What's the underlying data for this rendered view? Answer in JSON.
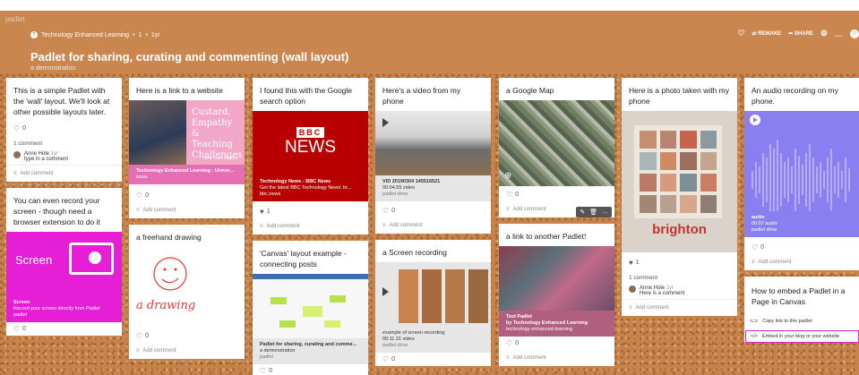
{
  "brand": "padlet",
  "breadcrumb": {
    "org": "Technology Enhanced Learning",
    "count": "1",
    "age": "1yr"
  },
  "title": "Padlet for sharing, curating and commenting (wall layout)",
  "subtitle": "a demonstration",
  "actions": {
    "remake": "REMAKE",
    "share": "SHARE"
  },
  "columns": [
    {
      "cards": [
        {
          "text": "This is a simple Padlet with the 'wall' layout. We'll look at other possible layouts later.",
          "likes": "0",
          "comments_count": "1 comment",
          "comment": {
            "author": "Anne Hole",
            "age": "1yr",
            "text": "type in a comment"
          },
          "add_comment": "Add comment"
        },
        {
          "text": "You can even record your screen - though need a browser extension to do it",
          "attachment": {
            "thumb_title": "Screen",
            "title": "Screen",
            "desc": "Record your screen directly from Padlet",
            "source": "padlet"
          },
          "likes": "0"
        }
      ]
    },
    {
      "cards": [
        {
          "text": "Here is a link to a website",
          "attachment": {
            "thumb_text": "Custard, Empathy & Teaching Challenges",
            "thumb_small": "New Case Studies",
            "title": "Technology Enhanced Learning : Univer...",
            "source": "issuu"
          },
          "likes": "0",
          "add_comment": "Add comment"
        },
        {
          "text": "a freehand drawing",
          "drawing_label": "a drawing",
          "likes": "0",
          "add_comment": "Add comment"
        }
      ]
    },
    {
      "cards": [
        {
          "text": "I found this with the Google search option",
          "attachment": {
            "thumb_logo": "BBC",
            "thumb_news": "NEWS",
            "title": "Technology News - BBC News",
            "desc": "Get the latest BBC Technology News: br...",
            "source": "bbc.news"
          },
          "likes": "1",
          "add_comment": "Add comment"
        },
        {
          "text": "'Canvas' layout example - connecting posts",
          "attachment": {
            "title": "Padlet for sharing, curating and comme...",
            "desc": "a demonstration",
            "source": "padlet"
          },
          "likes": "0"
        }
      ]
    },
    {
      "cards": [
        {
          "text": "Here's a video from my phone",
          "attachment": {
            "title": "VID 20190304 145516521",
            "desc": "00:04.55 video",
            "source": "padlet drive"
          },
          "likes": "0",
          "add_comment": "Add comment"
        },
        {
          "text": "a Screen recording",
          "attachment": {
            "title": "example of screen recording",
            "desc": "00:11.31 video",
            "source": "padlet drive"
          },
          "likes": "0"
        }
      ]
    },
    {
      "cards": [
        {
          "text": "a Google Map",
          "likes": "0",
          "add_comment": "Add comment"
        },
        {
          "text": "a link to another Padlet!",
          "attachment": {
            "title": "Test Padlet",
            "desc": "by Technology Enhanced Learning",
            "source": "technology-enhanced-learning"
          },
          "likes": "0",
          "add_comment": "Add comment"
        }
      ]
    },
    {
      "cards": [
        {
          "text": "Here is a photo taken with my phone",
          "photo_text": "brighton",
          "likes": "1",
          "comments_count": "1 comment",
          "comment": {
            "author": "Anne Hole",
            "age": "1yr",
            "text": "Here is a comment"
          },
          "add_comment": "Add comment"
        }
      ]
    },
    {
      "cards": [
        {
          "text": "An audio recording on my phone.",
          "attachment": {
            "title": "audio",
            "desc": "00:07 audio",
            "source": "padlet drive"
          },
          "likes": "0",
          "add_comment": "Add comment"
        },
        {
          "text": "How to embed a Padlet in a Page in Canvas",
          "links": [
            "Copy link to this padlet",
            "Embed in your blog or your website"
          ]
        }
      ]
    }
  ]
}
